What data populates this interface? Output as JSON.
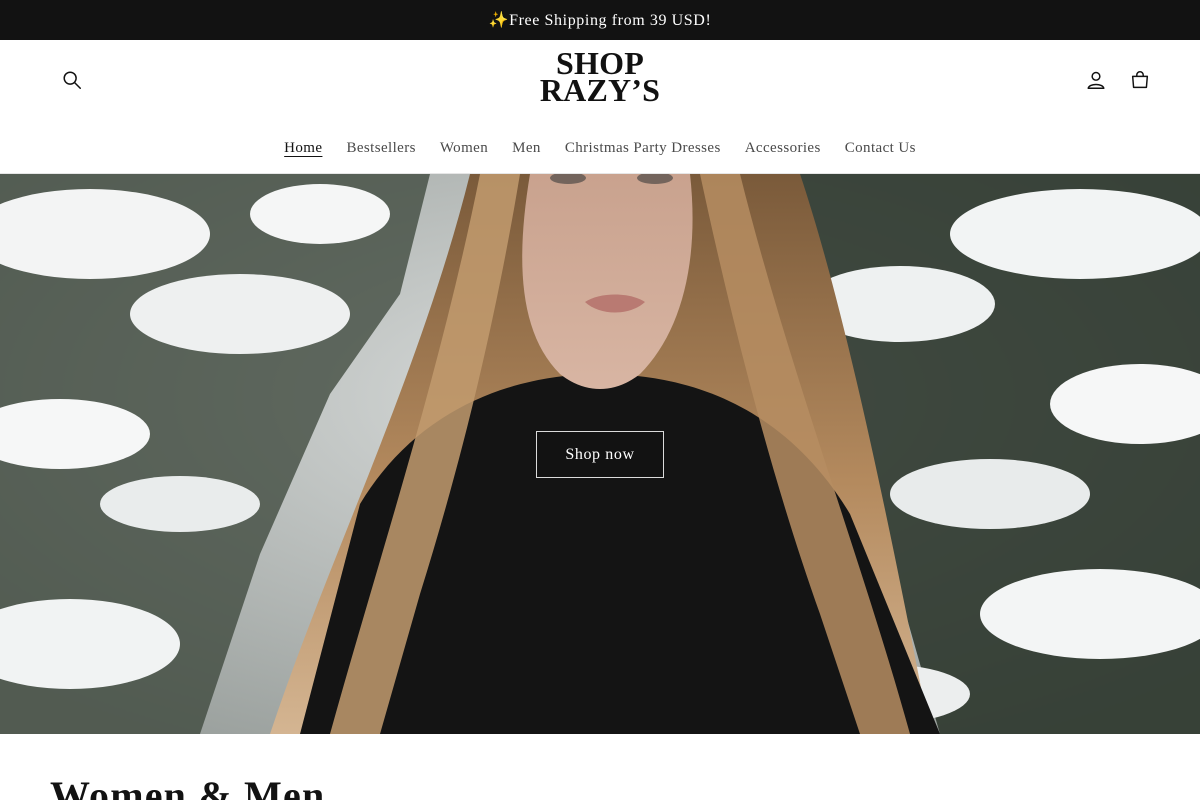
{
  "announcement": {
    "text": "✨Free Shipping from 39 USD!"
  },
  "header": {
    "logo": {
      "line1": "SHOP",
      "line2": "RAZY’S"
    },
    "icons": {
      "search": "search-icon",
      "account": "account-icon",
      "cart": "cart-icon"
    }
  },
  "nav": {
    "items": [
      {
        "label": "Home",
        "active": true
      },
      {
        "label": "Bestsellers",
        "active": false
      },
      {
        "label": "Women",
        "active": false
      },
      {
        "label": "Men",
        "active": false
      },
      {
        "label": "Christmas Party Dresses",
        "active": false
      },
      {
        "label": "Accessories",
        "active": false
      },
      {
        "label": "Contact Us",
        "active": false
      }
    ]
  },
  "hero": {
    "button_label": "Shop now"
  },
  "section": {
    "heading": "Women & Men"
  },
  "colors": {
    "announcement_bg": "#121212",
    "text": "#121212",
    "nav_text": "#4a4a4a"
  }
}
